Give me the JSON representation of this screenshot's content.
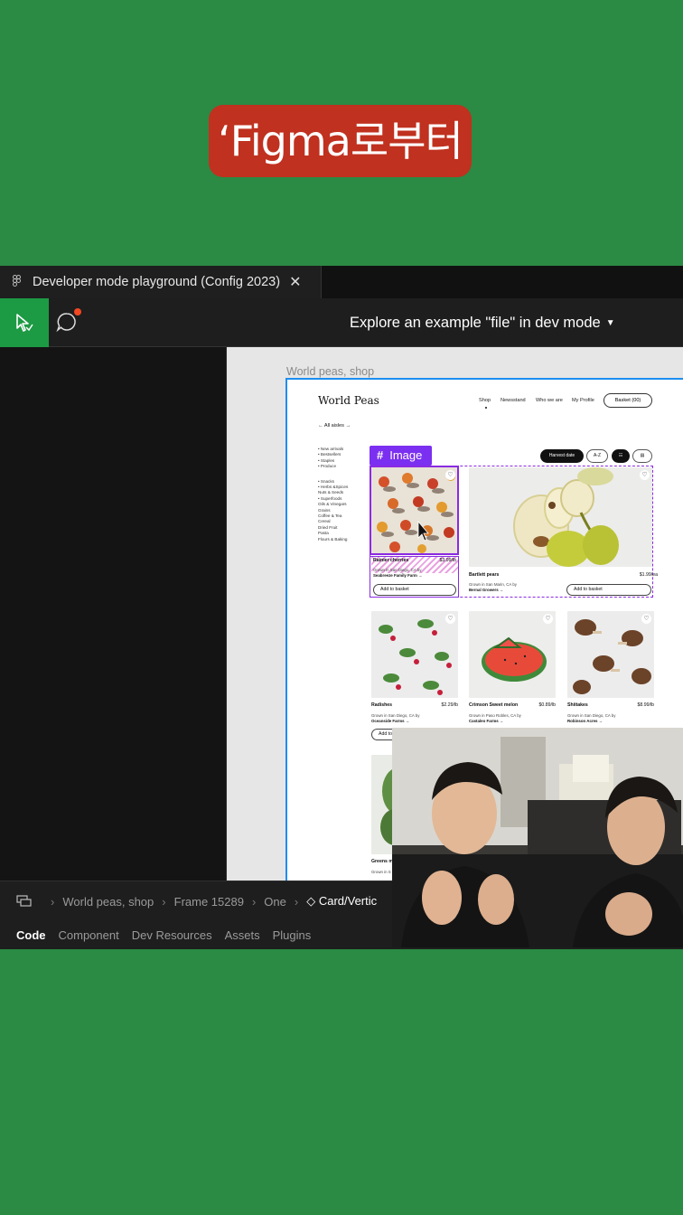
{
  "caption": "‘Figma로부터",
  "tab": {
    "title": "Developer mode playground (Config 2023)"
  },
  "toolbar": {
    "explore_label": "Explore an example \"file\" in dev mode"
  },
  "canvas": {
    "frame_label": "World peas, shop",
    "image_tag": "Image"
  },
  "site": {
    "logo": "World Peas",
    "nav": [
      "Shop",
      "Newsstand",
      "Who we are",
      "My Profile"
    ],
    "basket": "Basket (00)",
    "all_aisles": "← All aisles →",
    "categories_top": [
      "• New arrivals",
      "• Bestsellers",
      "• Staples",
      "• Produce"
    ],
    "categories_bottom": [
      "• Snacks",
      "• Herbs &Spices",
      "Nuts & Seeds",
      "• Superfoods",
      "Oils & Vinegars",
      "Grains",
      "Coffee & Tea",
      "Cereal",
      "Dried Fruit",
      "Pasta",
      "Flours & Baking"
    ],
    "filters": [
      "Harvest date",
      "A-Z",
      "☷",
      "▤"
    ],
    "products": [
      {
        "name": "Rainier cherries",
        "price": "$3.99/lb",
        "grown": "Grown in San Diego, CA by",
        "farm": "Seabreeze Family Farm →",
        "basket": "Add to basket"
      },
      {
        "name": "Bartlett pears",
        "price": "$1.99/ea",
        "grown": "Grown in San Marin, CA by",
        "farm": "Bernal Growers →",
        "basket": "Add to basket"
      },
      {
        "name": "Radishes",
        "price": "$2.29/lb",
        "grown": "Grown in San Diego, CA by",
        "farm": "Oceanside Farms →",
        "basket": "Add to"
      },
      {
        "name": "Crimson Sweet melon",
        "price": "$0.89/lb",
        "grown": "Grown in Paso Robles, CA by",
        "farm": "Castaleo Farms →",
        "basket": ""
      },
      {
        "name": "Shiitakes",
        "price": "$8.99/lb",
        "grown": "Grown in San Diego, CA by",
        "farm": "Robinson Acres →",
        "basket": ""
      },
      {
        "name": "Greens m",
        "price": "",
        "grown": "Grown in S",
        "farm": "",
        "basket": ""
      }
    ]
  },
  "breadcrumbs": [
    "World peas, shop",
    "Frame 15289",
    "One",
    "◇ Card/Vertic"
  ],
  "panel_tabs": [
    "Code",
    "Component",
    "Dev Resources",
    "Assets",
    "Plugins"
  ],
  "colors": {
    "background": "#2b8a44",
    "caption_bg": "#c0311f",
    "accent": "#1d9a44",
    "selection": "#8a2be2",
    "frame_border": "#1c8ef0"
  }
}
